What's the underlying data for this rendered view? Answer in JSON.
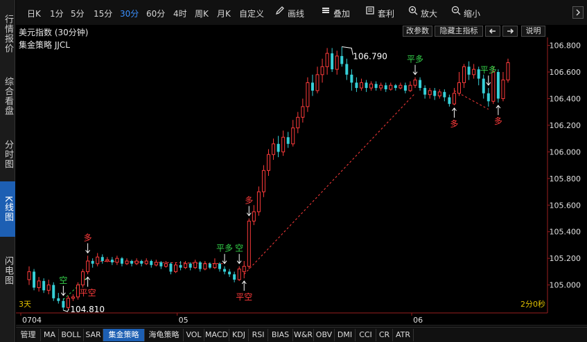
{
  "left_tabs": [
    {
      "label": "行情报价",
      "active": false
    },
    {
      "label": "综合看盘",
      "active": false
    },
    {
      "label": "分时图",
      "active": false
    },
    {
      "label": "K线图",
      "active": true
    },
    {
      "label": "闪电图",
      "active": false
    }
  ],
  "periods": [
    "日K",
    "1分",
    "5分",
    "15分",
    "30分",
    "60分",
    "4时",
    "周K",
    "月K",
    "自定义"
  ],
  "selected_period": "30分",
  "tools": {
    "draw": "画线",
    "overlay": "叠加",
    "arbitrage": "套利",
    "zoom_in": "放大",
    "zoom_out": "缩小"
  },
  "title": "美元指数 (30分钟)",
  "strategy_label": "集金策略 JJCL",
  "buttons": {
    "params": "改参数",
    "hide": "隐藏主指标",
    "help": "说明"
  },
  "colors": {
    "up": "#ff3b3b",
    "down": "#36d0d8",
    "signal_green": "#34d24a",
    "signal_red": "#ff3b3b",
    "dashed": "#ff3b3b",
    "axis": "#9a1f1f",
    "accent": "#1d5fb3"
  },
  "chart_data": {
    "type": "candlestick",
    "ylim": [
      104.79,
      106.86
    ],
    "y_ticks": [
      "106.800",
      "106.600",
      "106.400",
      "106.200",
      "106.000",
      "105.800",
      "105.600",
      "105.400",
      "105.200",
      "105.000"
    ],
    "x_ticks": [
      "0704",
      "05",
      "06"
    ],
    "high_label": "106.790",
    "low_label": "104.810",
    "days_label": "3天",
    "countdown": "2分0秒",
    "candles": [
      [
        105.04,
        105.1,
        105.14,
        105.0
      ],
      [
        105.1,
        104.98,
        105.12,
        104.96
      ],
      [
        104.98,
        105.03,
        105.06,
        104.95
      ],
      [
        105.03,
        104.96,
        105.05,
        104.94
      ],
      [
        104.96,
        105.0,
        105.04,
        104.93
      ],
      [
        105.0,
        104.9,
        105.02,
        104.88
      ],
      [
        104.9,
        104.88,
        104.94,
        104.86
      ],
      [
        104.88,
        104.83,
        104.9,
        104.81
      ],
      [
        104.83,
        104.9,
        104.92,
        104.82
      ],
      [
        104.9,
        104.91,
        104.93,
        104.88
      ],
      [
        104.91,
        105.0,
        105.02,
        104.89
      ],
      [
        105.0,
        105.1,
        105.12,
        104.98
      ],
      [
        105.1,
        105.18,
        105.22,
        105.08
      ],
      [
        105.18,
        105.16,
        105.2,
        105.13
      ],
      [
        105.16,
        105.21,
        105.24,
        105.14
      ],
      [
        105.21,
        105.18,
        105.23,
        105.16
      ],
      [
        105.18,
        105.19,
        105.21,
        105.17
      ],
      [
        105.19,
        105.17,
        105.21,
        105.15
      ],
      [
        105.17,
        105.2,
        105.22,
        105.15
      ],
      [
        105.2,
        105.16,
        105.21,
        105.14
      ],
      [
        105.16,
        105.18,
        105.2,
        105.15
      ],
      [
        105.18,
        105.16,
        105.19,
        105.14
      ],
      [
        105.16,
        105.18,
        105.2,
        105.15
      ],
      [
        105.18,
        105.16,
        105.19,
        105.14
      ],
      [
        105.16,
        105.18,
        105.2,
        105.15
      ],
      [
        105.18,
        105.15,
        105.19,
        105.13
      ],
      [
        105.15,
        105.17,
        105.19,
        105.14
      ],
      [
        105.17,
        105.14,
        105.18,
        105.12
      ],
      [
        105.14,
        105.16,
        105.18,
        105.13
      ],
      [
        105.16,
        105.1,
        105.17,
        105.08
      ],
      [
        105.1,
        105.15,
        105.17,
        105.09
      ],
      [
        105.15,
        105.13,
        105.18,
        105.11
      ],
      [
        105.13,
        105.16,
        105.18,
        105.12
      ],
      [
        105.16,
        105.13,
        105.17,
        105.11
      ],
      [
        105.13,
        105.17,
        105.19,
        105.12
      ],
      [
        105.17,
        105.12,
        105.18,
        105.1
      ],
      [
        105.12,
        105.16,
        105.18,
        105.11
      ],
      [
        105.16,
        105.13,
        105.17,
        105.12
      ],
      [
        105.13,
        105.16,
        105.2,
        105.12
      ],
      [
        105.16,
        105.12,
        105.17,
        105.1
      ],
      [
        105.12,
        105.1,
        105.14,
        105.08
      ],
      [
        105.1,
        105.08,
        105.12,
        105.06
      ],
      [
        105.08,
        105.04,
        105.1,
        105.02
      ],
      [
        105.04,
        105.12,
        105.14,
        105.03
      ],
      [
        105.1,
        105.14,
        105.18,
        105.05
      ],
      [
        105.14,
        105.48,
        105.5,
        105.12
      ],
      [
        105.48,
        105.55,
        105.6,
        105.45
      ],
      [
        105.55,
        105.7,
        105.74,
        105.52
      ],
      [
        105.7,
        105.86,
        105.9,
        105.66
      ],
      [
        105.86,
        105.98,
        106.02,
        105.82
      ],
      [
        105.98,
        106.06,
        106.1,
        105.94
      ],
      [
        106.06,
        106.0,
        106.12,
        105.96
      ],
      [
        106.0,
        106.11,
        106.16,
        105.97
      ],
      [
        106.11,
        106.06,
        106.15,
        106.03
      ],
      [
        106.06,
        106.18,
        106.24,
        106.04
      ],
      [
        106.18,
        106.26,
        106.3,
        106.14
      ],
      [
        106.26,
        106.34,
        106.4,
        106.22
      ],
      [
        106.34,
        106.52,
        106.56,
        106.3
      ],
      [
        106.52,
        106.46,
        106.58,
        106.42
      ],
      [
        106.46,
        106.58,
        106.64,
        106.44
      ],
      [
        106.58,
        106.64,
        106.7,
        106.52
      ],
      [
        106.64,
        106.74,
        106.78,
        106.58
      ],
      [
        106.74,
        106.62,
        106.78,
        106.6
      ],
      [
        106.62,
        106.72,
        106.76,
        106.58
      ],
      [
        106.72,
        106.66,
        106.79,
        106.64
      ],
      [
        106.66,
        106.58,
        106.7,
        106.54
      ],
      [
        106.58,
        106.52,
        106.62,
        106.46
      ],
      [
        106.52,
        106.48,
        106.56,
        106.45
      ],
      [
        106.48,
        106.52,
        106.55,
        106.46
      ],
      [
        106.52,
        106.48,
        106.54,
        106.45
      ],
      [
        106.48,
        106.51,
        106.53,
        106.46
      ],
      [
        106.51,
        106.48,
        106.53,
        106.46
      ],
      [
        106.48,
        106.5,
        106.52,
        106.46
      ],
      [
        106.5,
        106.47,
        106.52,
        106.45
      ],
      [
        106.47,
        106.5,
        106.52,
        106.46
      ],
      [
        106.5,
        106.48,
        106.51,
        106.46
      ],
      [
        106.48,
        106.5,
        106.52,
        106.47
      ],
      [
        106.5,
        106.46,
        106.52,
        106.44
      ],
      [
        106.46,
        106.5,
        106.53,
        106.45
      ],
      [
        106.5,
        106.54,
        106.56,
        106.48
      ],
      [
        106.54,
        106.48,
        106.56,
        106.46
      ],
      [
        106.48,
        106.43,
        106.5,
        106.4
      ],
      [
        106.43,
        106.46,
        106.48,
        106.4
      ],
      [
        106.46,
        106.42,
        106.48,
        106.39
      ],
      [
        106.42,
        106.45,
        106.47,
        106.4
      ],
      [
        106.45,
        106.41,
        106.47,
        106.38
      ],
      [
        106.41,
        106.36,
        106.43,
        106.34
      ],
      [
        106.36,
        106.44,
        106.48,
        106.35
      ],
      [
        106.44,
        106.52,
        106.6,
        106.42
      ],
      [
        106.52,
        106.64,
        106.66,
        106.48
      ],
      [
        106.64,
        106.58,
        106.68,
        106.54
      ],
      [
        106.58,
        106.62,
        106.66,
        106.55
      ],
      [
        106.62,
        106.55,
        106.64,
        106.5
      ],
      [
        106.55,
        106.44,
        106.58,
        106.4
      ],
      [
        106.44,
        106.38,
        106.48,
        106.34
      ],
      [
        106.38,
        106.6,
        106.64,
        106.36
      ],
      [
        106.6,
        106.4,
        106.62,
        106.37
      ],
      [
        106.4,
        106.54,
        106.6,
        106.38
      ],
      [
        106.54,
        106.67,
        106.7,
        106.52
      ]
    ],
    "signals": [
      {
        "text": "空",
        "i": 7,
        "pos": "above",
        "color": "green"
      },
      {
        "text": "多",
        "i": 12,
        "pos": "above",
        "color": "red"
      },
      {
        "text": "平空",
        "i": 12,
        "pos": "below",
        "color": "red"
      },
      {
        "text": "平多",
        "i": 40,
        "pos": "above",
        "color": "green"
      },
      {
        "text": "空",
        "i": 43,
        "pos": "above",
        "color": "green"
      },
      {
        "text": "平空",
        "i": 44,
        "pos": "below",
        "color": "red"
      },
      {
        "text": "多",
        "i": 45,
        "pos": "above",
        "color": "red"
      },
      {
        "text": "平多",
        "i": 79,
        "pos": "above",
        "color": "green"
      },
      {
        "text": "多",
        "i": 87,
        "pos": "below",
        "color": "red"
      },
      {
        "text": "平多",
        "i": 94,
        "pos": "above",
        "color": "green"
      },
      {
        "text": "多",
        "i": 96,
        "pos": "below",
        "color": "red"
      }
    ],
    "links": [
      {
        "from": [
          7,
          104.89
        ],
        "to": [
          12,
          105.06
        ],
        "color": "green"
      },
      {
        "from": [
          12,
          105.18
        ],
        "to": [
          40,
          105.16
        ],
        "color": "red"
      },
      {
        "from": [
          44,
          105.08
        ],
        "to": [
          79,
          106.44
        ],
        "color": "red"
      },
      {
        "from": [
          87,
          106.46
        ],
        "to": [
          94,
          106.32
        ],
        "color": "red"
      }
    ]
  },
  "bottom_tabs": [
    "管理",
    "MA",
    "BOLL",
    "SAR",
    "集金策略",
    "海龟策略",
    "VOL",
    "MACD",
    "KDJ",
    "RSI",
    "BIAS",
    "W&R",
    "OBV",
    "DMI",
    "CCI",
    "CR",
    "ATR"
  ],
  "selected_bottom": "集金策略"
}
